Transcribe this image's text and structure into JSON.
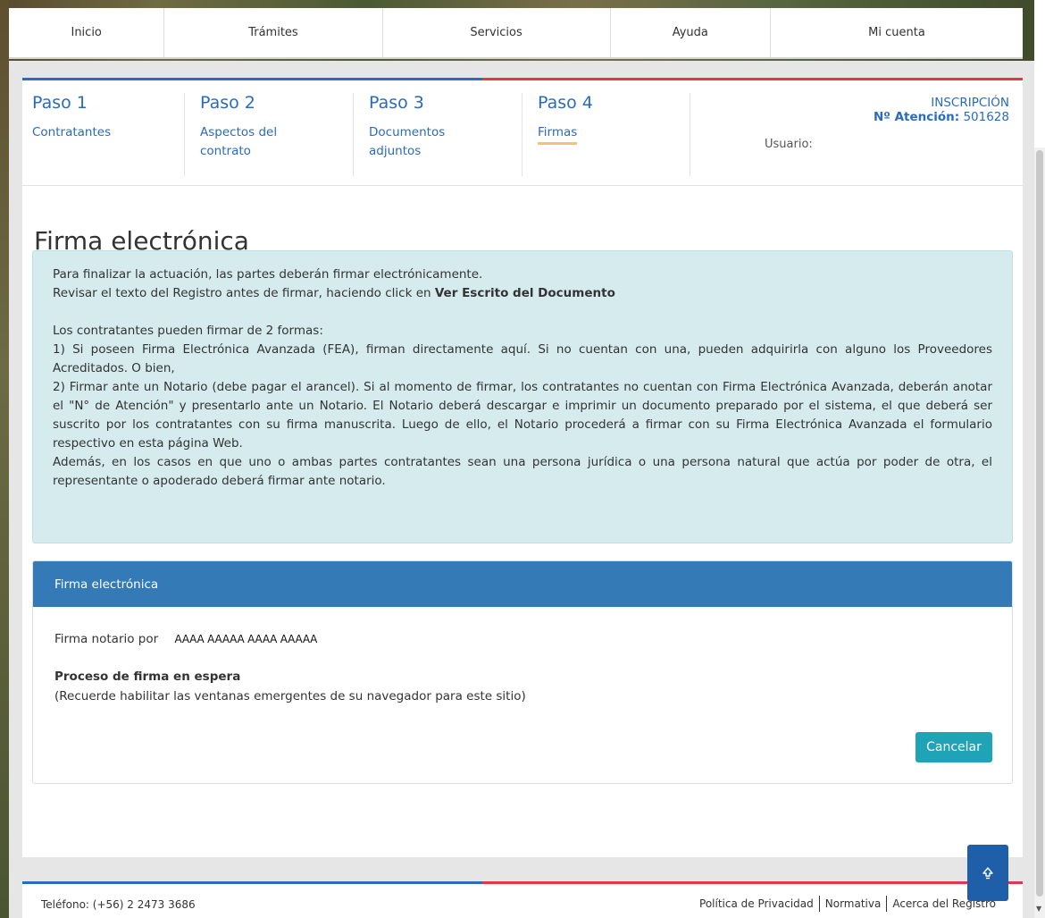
{
  "nav": {
    "items": [
      "Inicio",
      "Trámites",
      "Servicios",
      "Ayuda",
      "Mi cuenta"
    ]
  },
  "steps": [
    {
      "title": "Paso 1",
      "label": "Contratantes"
    },
    {
      "title": "Paso 2",
      "label": "Aspectos del contrato"
    },
    {
      "title": "Paso 3",
      "label": "Documentos adjuntos"
    },
    {
      "title": "Paso 4",
      "label": "Firmas"
    }
  ],
  "header": {
    "inscripcion": "INSCRIPCIÓN",
    "atencion_label": "Nº Atención:",
    "atencion_value": "501628",
    "usuario_label": "Usuario:"
  },
  "page_title": "Firma electrónica",
  "info": {
    "line1": "Para finalizar la actuación, las partes deberán firmar electrónicamente.",
    "line2_prefix": "Revisar el texto del Registro antes de firmar, haciendo click en ",
    "line2_bold": "Ver Escrito del Documento",
    "line3": "Los contratantes pueden firmar de 2 formas:",
    "line4": "1) Si poseen Firma Electrónica Avanzada (FEA), firman directamente aquí. Si no cuentan con una, pueden adquirirla con alguno los Proveedores Acreditados. O bien,",
    "line5": "2) Firmar ante un Notario (debe pagar el arancel). Si al momento de firmar, los contratantes no cuentan con Firma Electrónica Avanzada, deberán anotar el \"N° de Atención\" y presentarlo ante un Notario. El Notario deberá descargar e imprimir un documento preparado por el sistema, el que deberá ser suscrito por los contratantes con su firma manuscrita. Luego de ello, el Notario procederá a firmar con su Firma Electrónica Avanzada el formulario respectivo en esta página Web.",
    "line6": "Además, en los  casos en que uno o ambas partes contratantes sean una persona jurídica o una persona natural que actúa por poder de otra, el representante o apoderado deberá firmar ante notario."
  },
  "panel": {
    "heading": "Firma electrónica",
    "firma_label": "Firma notario por",
    "firma_value": "AAAA AAAAA AAAA  AAAAA",
    "process_title": "Proceso de firma en espera",
    "process_note": "(Recuerde habilitar las ventanas emergentes de su navegador para este sitio)",
    "cancel_label": "Cancelar"
  },
  "footer": {
    "phone": "Teléfono: (+56) 2 2473 3686",
    "links": [
      "Política de Privacidad",
      "Normativa",
      "Acerca del Registro"
    ]
  },
  "colors": {
    "primary_blue": "#2a6bbf",
    "panel_blue": "#337ab7",
    "accent_red": "#e1374b",
    "info_bg": "#d5ebee",
    "button_teal": "#1fa3b7"
  },
  "icons": {
    "scroll_top": "arrow-up-icon"
  }
}
